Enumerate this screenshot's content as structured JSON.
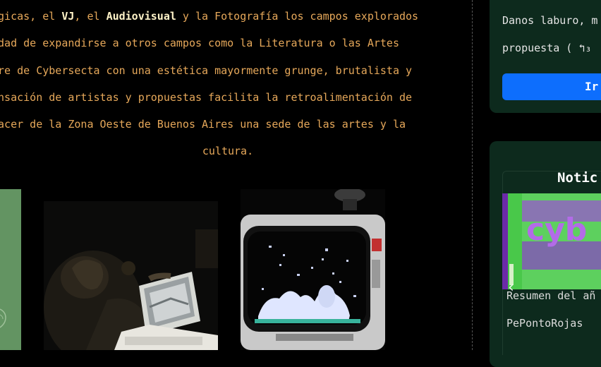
{
  "about": {
    "lines": [
      {
        "a": "ógicas, el ",
        "b1": "VJ",
        "c": ", el ",
        "b2": "Audiovisual",
        "d": " y la Fotografía los campos explorados"
      },
      {
        "a": "idad de expandirse a otros campos como la Literatura o las Artes"
      },
      {
        "a": "bre de Cybersecta con una estética mayormente grunge, brutalista y"
      },
      {
        "a": "ensación de artistas y propuestas facilita la retroalimentación de"
      },
      {
        "a": "hacer de la Zona Oeste de Buenos Aires una sede de las artes y la"
      },
      {
        "a": "cultura."
      }
    ]
  },
  "sidebar": {
    "promo": {
      "line1": "Danos laburo, m",
      "line2": "propuesta ( ↰₃",
      "button_label": "Ir"
    },
    "news": {
      "title": "Notic",
      "caption": "Resumen del añ",
      "author": "PePontoRojas",
      "prev_icon": "chevron-left-icon",
      "image_word": "cyb"
    }
  },
  "colors": {
    "background": "#000000",
    "body_text": "#e6a85a",
    "bold_text": "#fff3c8",
    "card_bg": "#0d2a1d",
    "button_bg": "#0d6efd"
  }
}
